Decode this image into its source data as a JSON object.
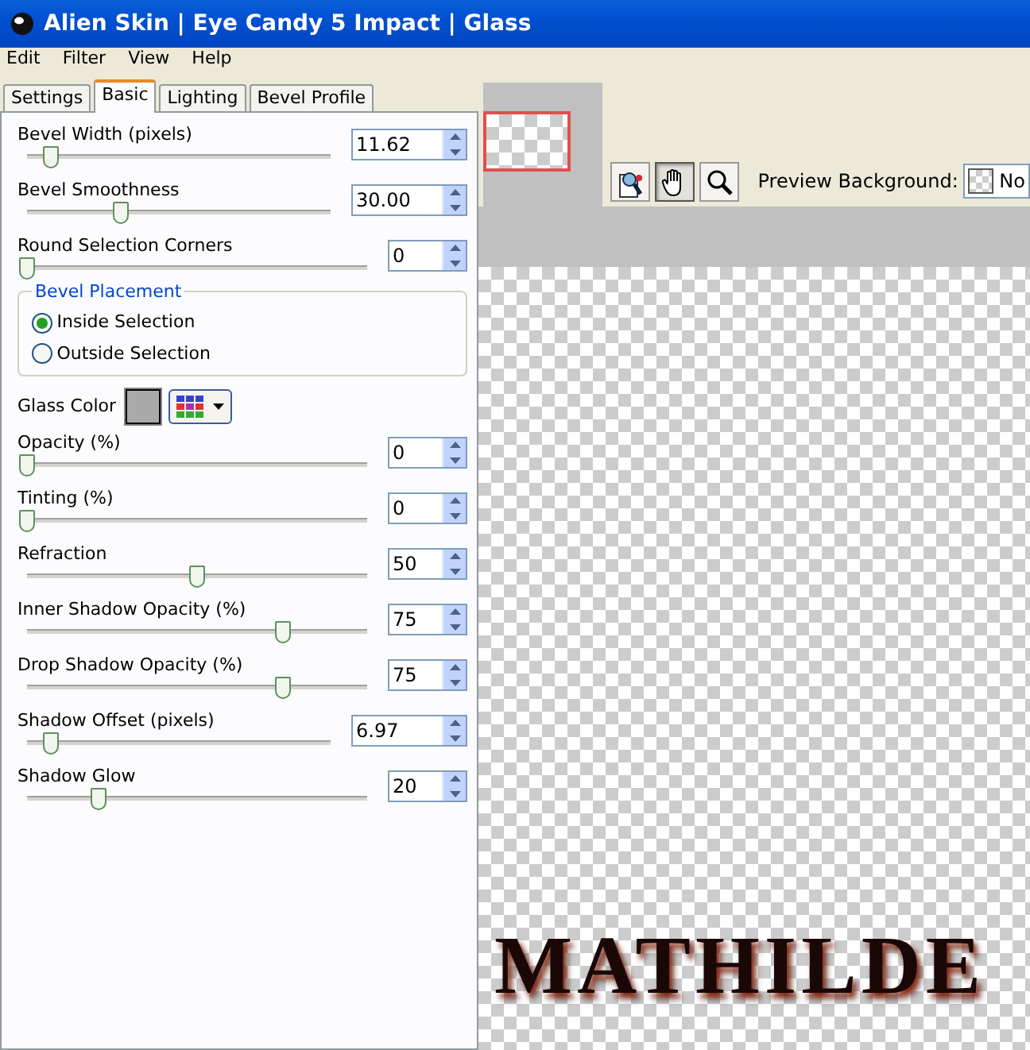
{
  "window": {
    "title": "Alien Skin | Eye Candy 5 Impact | Glass"
  },
  "menu": [
    "Edit",
    "Filter",
    "View",
    "Help"
  ],
  "tabs": [
    {
      "label": "Settings",
      "selected": false
    },
    {
      "label": "Basic",
      "selected": true
    },
    {
      "label": "Lighting",
      "selected": false
    },
    {
      "label": "Bevel Profile",
      "selected": false
    }
  ],
  "controls": [
    {
      "kind": "decimal",
      "label": "Bevel Width (pixels)",
      "value": "11.62",
      "level": 0.08
    },
    {
      "kind": "decimal",
      "label": "Bevel Smoothness",
      "value": "30.00",
      "level": 0.31
    },
    {
      "kind": "integer",
      "label": "Round Selection Corners",
      "value": "0",
      "level": 0
    },
    {
      "kind": "group",
      "label": "Bevel Placement",
      "options": [
        {
          "label": "Inside Selection",
          "selected": true
        },
        {
          "label": "Outside Selection",
          "selected": false
        }
      ]
    },
    {
      "kind": "color",
      "label": "Glass Color"
    },
    {
      "kind": "integer",
      "label": "Opacity (%)",
      "value": "0",
      "level": 0
    },
    {
      "kind": "integer",
      "label": "Tinting (%)",
      "value": "0",
      "level": 0
    },
    {
      "kind": "integer",
      "label": "Refraction",
      "value": "50",
      "level": 0.5
    },
    {
      "kind": "integer",
      "label": "Inner Shadow Opacity (%)",
      "value": "75",
      "level": 0.75
    },
    {
      "kind": "integer",
      "label": "Drop Shadow Opacity (%)",
      "value": "75",
      "level": 0.75
    },
    {
      "kind": "decimal",
      "label": "Shadow Offset (pixels)",
      "value": "6.97",
      "level": 0.08
    },
    {
      "kind": "integer",
      "label": "Shadow Glow",
      "value": "20",
      "level": 0.21
    }
  ],
  "tools": [
    {
      "kind": "compare",
      "selected": false
    },
    {
      "kind": "hand",
      "selected": true
    },
    {
      "kind": "zoom",
      "selected": false
    }
  ],
  "preview": {
    "background_label": "Preview Background:",
    "background_value": "No",
    "canvas_text": "MATHILDE"
  }
}
